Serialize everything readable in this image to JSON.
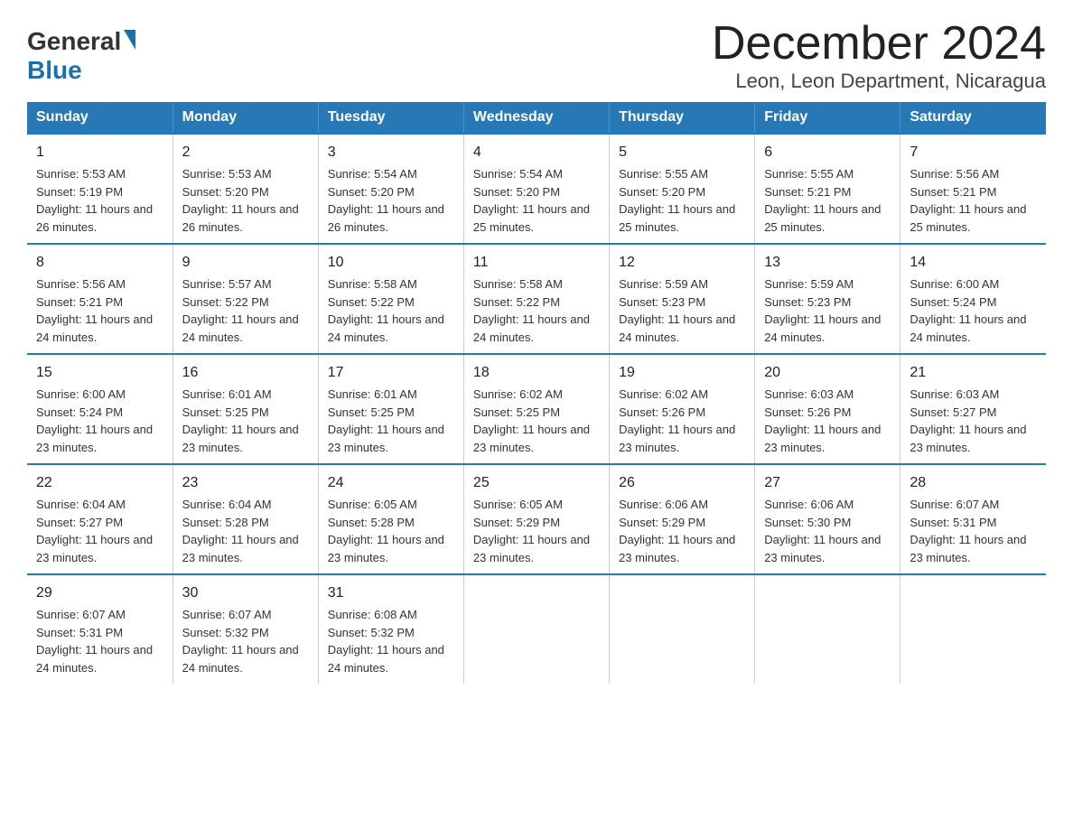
{
  "logo": {
    "general": "General",
    "blue": "Blue",
    "triangle_color": "#1a6fad"
  },
  "header": {
    "title": "December 2024",
    "subtitle": "Leon, Leon Department, Nicaragua"
  },
  "calendar": {
    "days_of_week": [
      "Sunday",
      "Monday",
      "Tuesday",
      "Wednesday",
      "Thursday",
      "Friday",
      "Saturday"
    ],
    "weeks": [
      [
        {
          "day": "1",
          "sunrise": "5:53 AM",
          "sunset": "5:19 PM",
          "daylight": "11 hours and 26 minutes."
        },
        {
          "day": "2",
          "sunrise": "5:53 AM",
          "sunset": "5:20 PM",
          "daylight": "11 hours and 26 minutes."
        },
        {
          "day": "3",
          "sunrise": "5:54 AM",
          "sunset": "5:20 PM",
          "daylight": "11 hours and 26 minutes."
        },
        {
          "day": "4",
          "sunrise": "5:54 AM",
          "sunset": "5:20 PM",
          "daylight": "11 hours and 25 minutes."
        },
        {
          "day": "5",
          "sunrise": "5:55 AM",
          "sunset": "5:20 PM",
          "daylight": "11 hours and 25 minutes."
        },
        {
          "day": "6",
          "sunrise": "5:55 AM",
          "sunset": "5:21 PM",
          "daylight": "11 hours and 25 minutes."
        },
        {
          "day": "7",
          "sunrise": "5:56 AM",
          "sunset": "5:21 PM",
          "daylight": "11 hours and 25 minutes."
        }
      ],
      [
        {
          "day": "8",
          "sunrise": "5:56 AM",
          "sunset": "5:21 PM",
          "daylight": "11 hours and 24 minutes."
        },
        {
          "day": "9",
          "sunrise": "5:57 AM",
          "sunset": "5:22 PM",
          "daylight": "11 hours and 24 minutes."
        },
        {
          "day": "10",
          "sunrise": "5:58 AM",
          "sunset": "5:22 PM",
          "daylight": "11 hours and 24 minutes."
        },
        {
          "day": "11",
          "sunrise": "5:58 AM",
          "sunset": "5:22 PM",
          "daylight": "11 hours and 24 minutes."
        },
        {
          "day": "12",
          "sunrise": "5:59 AM",
          "sunset": "5:23 PM",
          "daylight": "11 hours and 24 minutes."
        },
        {
          "day": "13",
          "sunrise": "5:59 AM",
          "sunset": "5:23 PM",
          "daylight": "11 hours and 24 minutes."
        },
        {
          "day": "14",
          "sunrise": "6:00 AM",
          "sunset": "5:24 PM",
          "daylight": "11 hours and 24 minutes."
        }
      ],
      [
        {
          "day": "15",
          "sunrise": "6:00 AM",
          "sunset": "5:24 PM",
          "daylight": "11 hours and 23 minutes."
        },
        {
          "day": "16",
          "sunrise": "6:01 AM",
          "sunset": "5:25 PM",
          "daylight": "11 hours and 23 minutes."
        },
        {
          "day": "17",
          "sunrise": "6:01 AM",
          "sunset": "5:25 PM",
          "daylight": "11 hours and 23 minutes."
        },
        {
          "day": "18",
          "sunrise": "6:02 AM",
          "sunset": "5:25 PM",
          "daylight": "11 hours and 23 minutes."
        },
        {
          "day": "19",
          "sunrise": "6:02 AM",
          "sunset": "5:26 PM",
          "daylight": "11 hours and 23 minutes."
        },
        {
          "day": "20",
          "sunrise": "6:03 AM",
          "sunset": "5:26 PM",
          "daylight": "11 hours and 23 minutes."
        },
        {
          "day": "21",
          "sunrise": "6:03 AM",
          "sunset": "5:27 PM",
          "daylight": "11 hours and 23 minutes."
        }
      ],
      [
        {
          "day": "22",
          "sunrise": "6:04 AM",
          "sunset": "5:27 PM",
          "daylight": "11 hours and 23 minutes."
        },
        {
          "day": "23",
          "sunrise": "6:04 AM",
          "sunset": "5:28 PM",
          "daylight": "11 hours and 23 minutes."
        },
        {
          "day": "24",
          "sunrise": "6:05 AM",
          "sunset": "5:28 PM",
          "daylight": "11 hours and 23 minutes."
        },
        {
          "day": "25",
          "sunrise": "6:05 AM",
          "sunset": "5:29 PM",
          "daylight": "11 hours and 23 minutes."
        },
        {
          "day": "26",
          "sunrise": "6:06 AM",
          "sunset": "5:29 PM",
          "daylight": "11 hours and 23 minutes."
        },
        {
          "day": "27",
          "sunrise": "6:06 AM",
          "sunset": "5:30 PM",
          "daylight": "11 hours and 23 minutes."
        },
        {
          "day": "28",
          "sunrise": "6:07 AM",
          "sunset": "5:31 PM",
          "daylight": "11 hours and 23 minutes."
        }
      ],
      [
        {
          "day": "29",
          "sunrise": "6:07 AM",
          "sunset": "5:31 PM",
          "daylight": "11 hours and 24 minutes."
        },
        {
          "day": "30",
          "sunrise": "6:07 AM",
          "sunset": "5:32 PM",
          "daylight": "11 hours and 24 minutes."
        },
        {
          "day": "31",
          "sunrise": "6:08 AM",
          "sunset": "5:32 PM",
          "daylight": "11 hours and 24 minutes."
        },
        null,
        null,
        null,
        null
      ]
    ],
    "labels": {
      "sunrise": "Sunrise:",
      "sunset": "Sunset:",
      "daylight": "Daylight:"
    }
  }
}
